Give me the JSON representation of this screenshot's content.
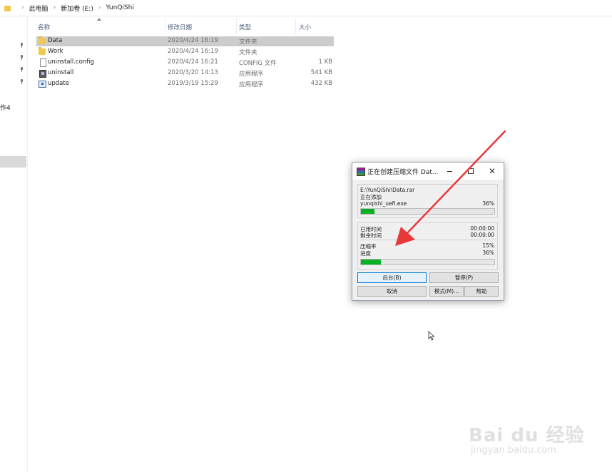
{
  "address_bar": {
    "breadcrumbs": [
      "此电脑",
      "新加卷 (E:)",
      "YunQiShi"
    ]
  },
  "nav_pane": {
    "partial_label": "作4"
  },
  "columns": {
    "name": "名称",
    "date": "修改日期",
    "type": "类型",
    "size": "大小"
  },
  "files": [
    {
      "name": "Data",
      "date": "2020/4/24 16:19",
      "type": "文件夹",
      "size": "",
      "icon": "folder-icon",
      "selected": true
    },
    {
      "name": "Work",
      "date": "2020/4/24 16:19",
      "type": "文件夹",
      "size": "",
      "icon": "folder-icon",
      "selected": false
    },
    {
      "name": "uninstall.config",
      "date": "2020/4/24 16:21",
      "type": "CONFIG 文件",
      "size": "1 KB",
      "icon": "config-file-icon",
      "selected": false
    },
    {
      "name": "uninstall",
      "date": "2020/3/20 14:13",
      "type": "应用程序",
      "size": "541 KB",
      "icon": "uninstall-exe-icon",
      "selected": false
    },
    {
      "name": "update",
      "date": "2019/3/19 15:29",
      "type": "应用程序",
      "size": "432 KB",
      "icon": "update-exe-icon",
      "selected": false
    }
  ],
  "dialog": {
    "title": "正在创建压缩文件 Dat...",
    "archive_path": "E:\\YunQiShi\\Data.rar",
    "action": "正在添加",
    "current_file": "yunqishi_uefi.exe",
    "current_percent": "36%",
    "current_progress": 0.1,
    "elapsed_label": "已用时间",
    "elapsed_value": "00:00:00",
    "remaining_label": "剩余时间",
    "remaining_value": "00:00:00",
    "ratio_label": "压缩率",
    "ratio_value": "15%",
    "progress_label": "进度",
    "progress_value": "36%",
    "total_progress": 0.15,
    "buttons": {
      "background": "后台(B)",
      "pause": "暂停(P)",
      "cancel": "取消",
      "mode": "模式(M)...",
      "help": "帮助"
    }
  },
  "watermark": {
    "logo": "Bai du 经验",
    "url": "jingyan.baidu.com"
  },
  "colors": {
    "progress_fill": "#06b025",
    "selection": "#cccccc",
    "annotation_arrow": "#e8393a"
  }
}
